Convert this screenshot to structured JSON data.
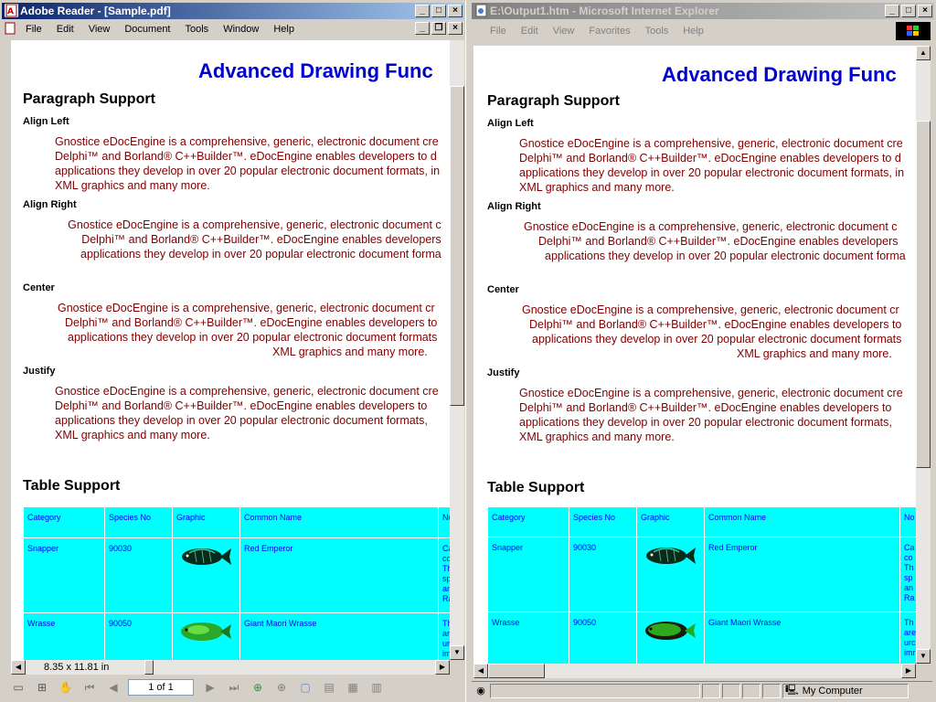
{
  "adobe": {
    "title": "Adobe Reader - [Sample.pdf]",
    "menu": [
      "File",
      "Edit",
      "View",
      "Document",
      "Tools",
      "Window",
      "Help"
    ],
    "page_size": "8.35 x 11.81 in",
    "page_box": "1 of 1"
  },
  "ie": {
    "title": "E:\\Output1.htm - Microsoft Internet Explorer",
    "menu": [
      "File",
      "Edit",
      "View",
      "Favorites",
      "Tools",
      "Help"
    ],
    "status_zone": "My Computer"
  },
  "document": {
    "heading": "Advanced Drawing Func",
    "paragraph_support": "Paragraph Support",
    "align_left": "Align Left",
    "align_right": "Align Right",
    "center": "Center",
    "justify": "Justify",
    "left_lines": [
      "Gnostice eDocEngine is a comprehensive, generic, electronic document cre",
      "Delphi™ and Borland® C++Builder™. eDocEngine enables developers to d",
      "applications they develop in over 20 popular electronic document formats, in",
      "XML graphics and many more."
    ],
    "right_lines": [
      "Gnostice eDocEngine is a comprehensive, generic, electronic document c",
      "Delphi™ and Borland® C++Builder™. eDocEngine enables developers",
      "applications they develop in over 20 popular electronic document forma"
    ],
    "center_lines": [
      "Gnostice eDocEngine is a comprehensive, generic, electronic document cr",
      "Delphi™ and Borland® C++Builder™. eDocEngine enables developers to",
      "applications they develop in over 20 popular electronic document formats",
      "XML graphics and many more."
    ],
    "justify_lines": [
      "Gnostice eDocEngine is a comprehensive, generic, electronic document cre",
      "Delphi™ and Borland® C++Builder™. eDocEngine enables developers  to",
      "applications they develop in over 20 popular  electronic  document  formats,",
      "XML graphics and many more."
    ],
    "table_support": "Table Support",
    "table_headers": [
      "Category",
      "Species No",
      "Graphic",
      "Common Name",
      "No"
    ],
    "rows": [
      {
        "category": "Snapper",
        "species": "90030",
        "common": "Red Emperor",
        "notes": [
          "Ca",
          "co",
          "Th",
          "sp",
          "an",
          "Ra"
        ]
      },
      {
        "category": "Wrasse",
        "species": "90050",
        "common": "Giant Maori Wrasse",
        "notes": [
          "Th",
          "are",
          "urc",
          "imr"
        ]
      }
    ]
  },
  "colors": {
    "heading": "#0000cc",
    "body_text": "#800000",
    "table_bg": "#00ffff",
    "table_text": "#0000ff"
  }
}
